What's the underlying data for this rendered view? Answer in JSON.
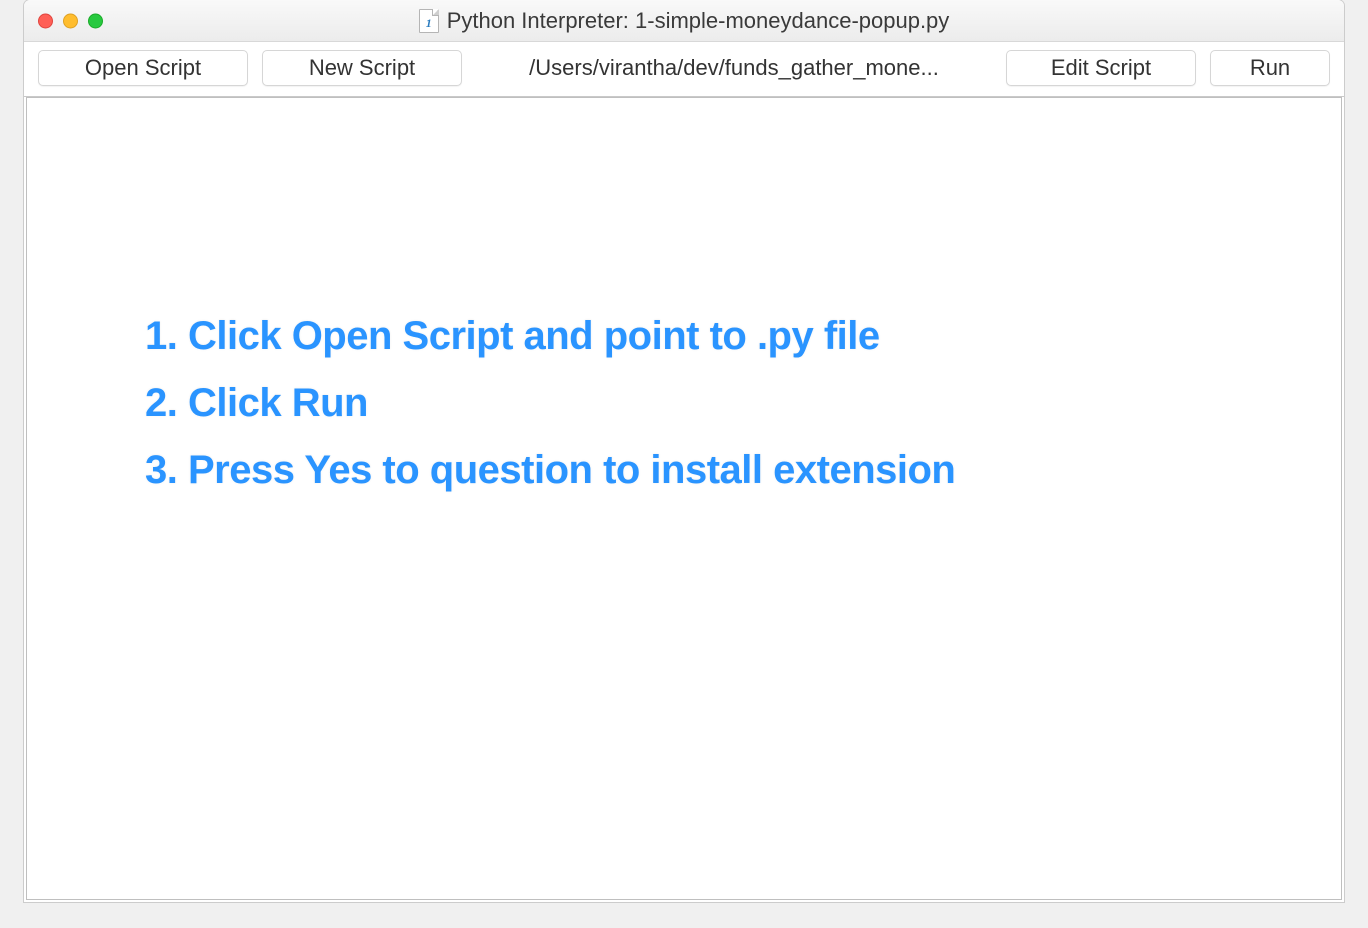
{
  "window": {
    "title": "Python Interpreter: 1-simple-moneydance-popup.py",
    "file_icon_glyph": "1"
  },
  "toolbar": {
    "open_script_label": "Open Script",
    "new_script_label": "New Script",
    "path_label": "/Users/virantha/dev/funds_gather_mone...",
    "edit_script_label": "Edit Script",
    "run_label": "Run"
  },
  "instructions": {
    "line1": "1. Click Open Script and point to .py file",
    "line2": "2. Click Run",
    "line3": "3. Press Yes to question to install extension"
  }
}
